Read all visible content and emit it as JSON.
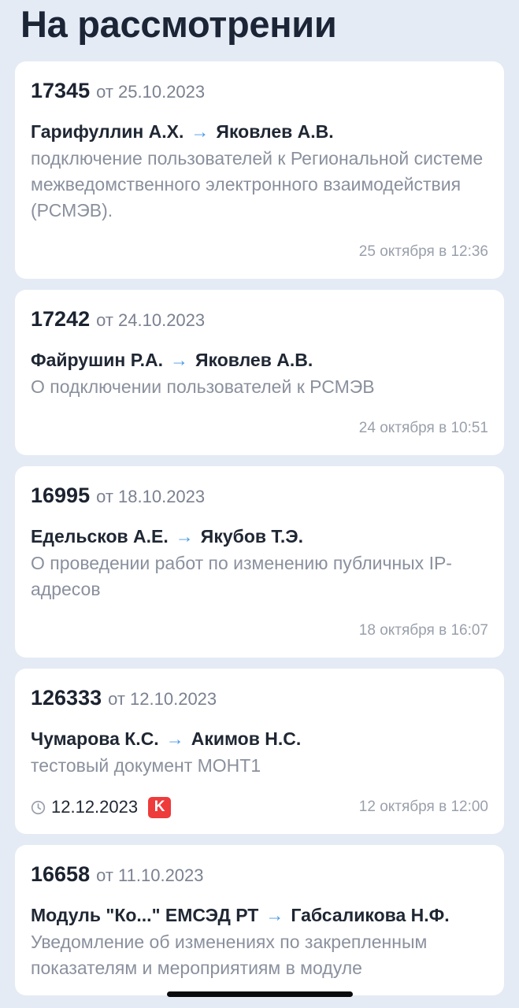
{
  "header": {
    "title": "На рассмотрении"
  },
  "documents": [
    {
      "number": "17345",
      "date": "от 25.10.2023",
      "from": "Гарифуллин А.Х.",
      "to": "Яковлев А.В.",
      "subject": "подключение пользователей к Региональной системе межведомственного электронного взаимодействия (РСМЭВ).",
      "received": "25 октября в 12:36",
      "deadline": "",
      "badge": ""
    },
    {
      "number": "17242",
      "date": "от 24.10.2023",
      "from": "Файрушин Р.А.",
      "to": "Яковлев А.В.",
      "subject": "О подключении пользователей к РСМЭВ",
      "received": "24 октября в 10:51",
      "deadline": "",
      "badge": ""
    },
    {
      "number": "16995",
      "date": "от 18.10.2023",
      "from": "Едельсков А.Е.",
      "to": "Якубов Т.Э.",
      "subject": "О проведении работ по изменению публичных IP-адресов",
      "received": "18 октября в 16:07",
      "deadline": "",
      "badge": ""
    },
    {
      "number": "126333",
      "date": "от 12.10.2023",
      "from": "Чумарова К.С.",
      "to": "Акимов Н.С.",
      "subject": "тестовый документ МОНТ1",
      "received": "12 октября в 12:00",
      "deadline": "12.12.2023",
      "badge": "K"
    },
    {
      "number": "16658",
      "date": "от 11.10.2023",
      "from": "Модуль \"Ко...\" ЕМСЭД РТ",
      "to": "Габсаликова Н.Ф.",
      "subject": "Уведомление об изменениях по закрепленным показателям и мероприятиям в модуле",
      "received": "",
      "deadline": "",
      "badge": ""
    }
  ],
  "icons": {
    "route_arrow": "arrow-right-icon",
    "deadline": "clock-icon"
  },
  "colors": {
    "accent": "#4a9be6",
    "badge": "#ee3b3b",
    "background": "#e4ebf5"
  }
}
